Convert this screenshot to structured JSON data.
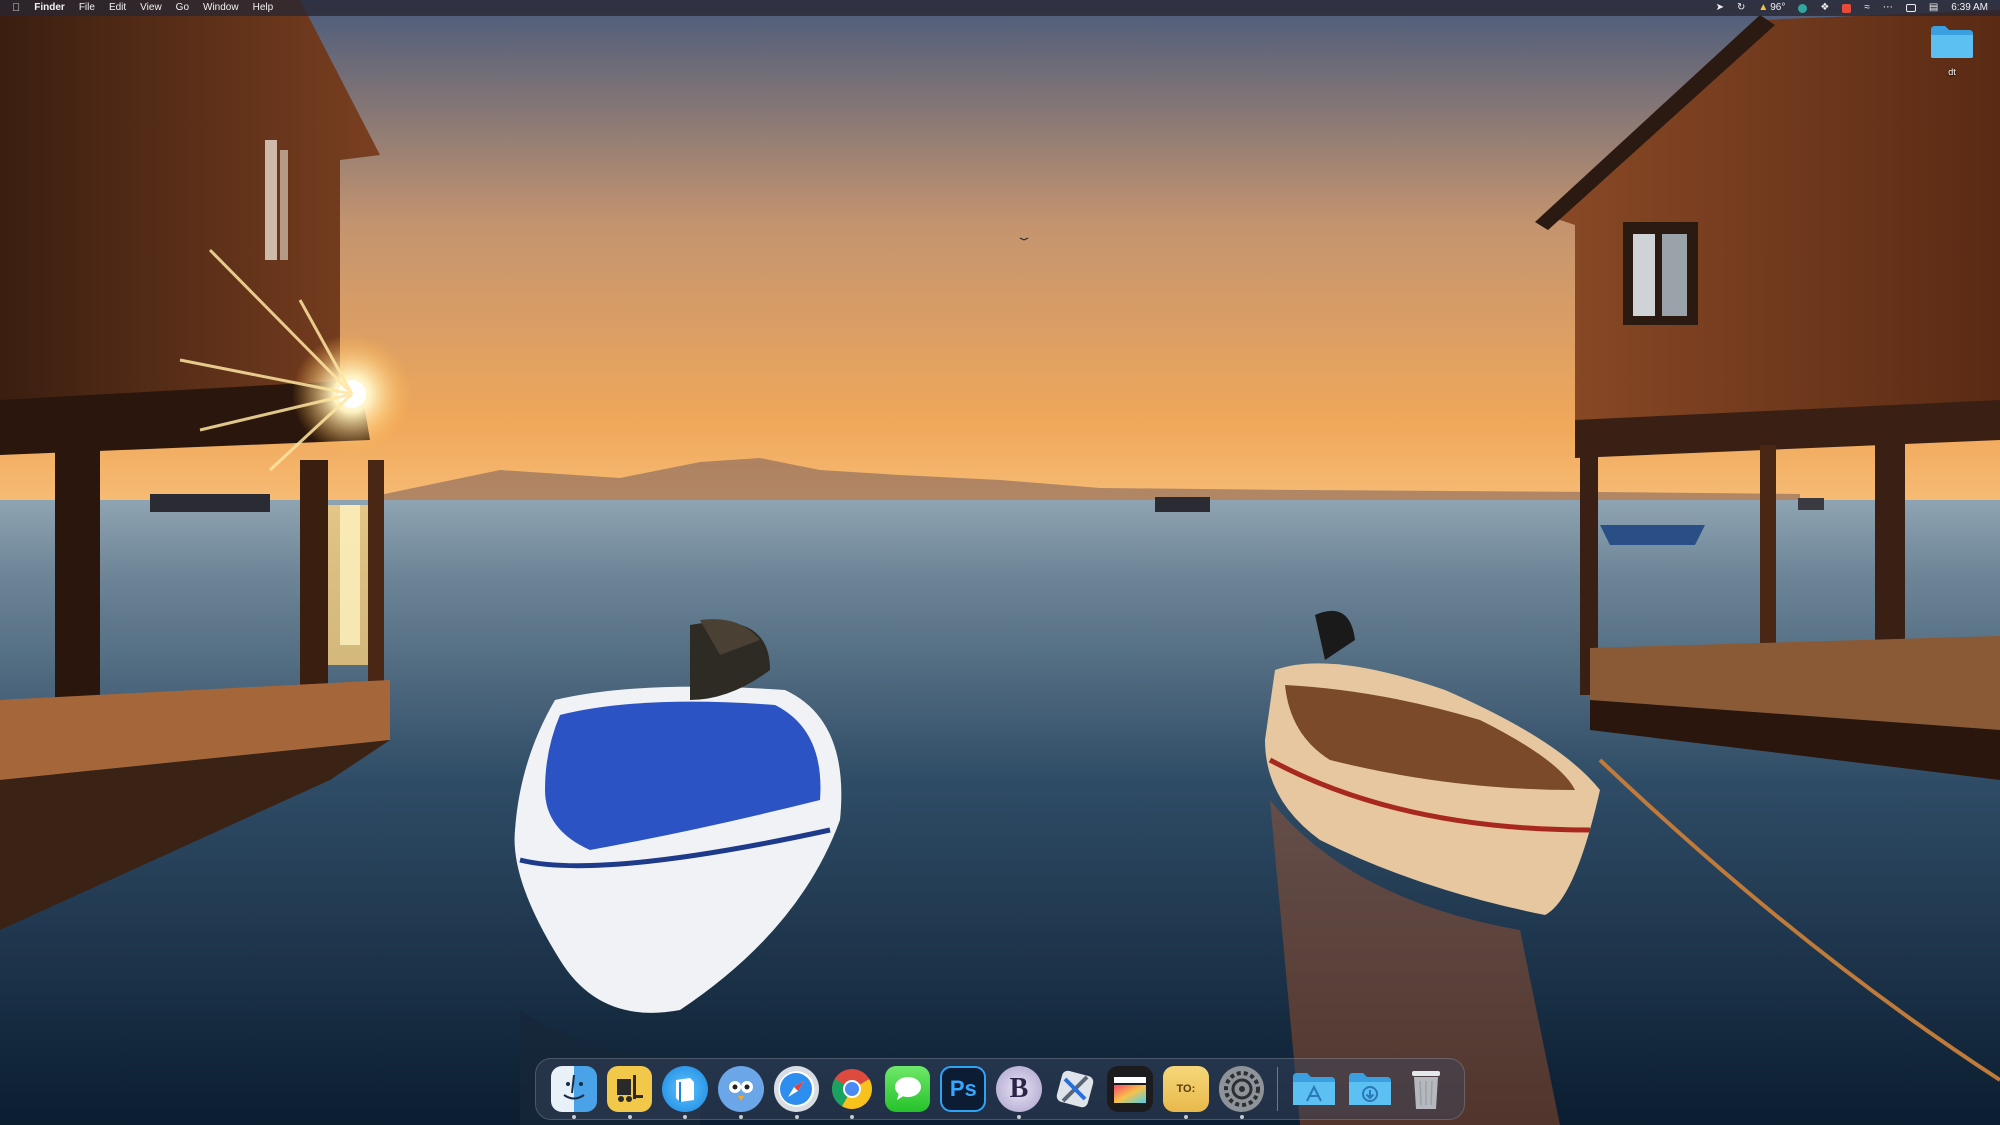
{
  "menubar": {
    "apple_icon": "apple-logo-icon",
    "app_name": "Finder",
    "menus": [
      "File",
      "Edit",
      "View",
      "Go",
      "Window",
      "Help"
    ],
    "status": {
      "location_icon": "location-arrow-icon",
      "sync_icon": "sync-icon",
      "temperature": "96°",
      "clock": "6:39 AM"
    }
  },
  "desktop": {
    "folder_label": "dt"
  },
  "dock": {
    "apps": [
      {
        "name": "Finder",
        "icon": "finder-icon"
      },
      {
        "name": "Forklift",
        "icon": "forklift-icon"
      },
      {
        "name": "Mail",
        "icon": "mail-icon"
      },
      {
        "name": "Tweetbot",
        "icon": "tweetbot-icon"
      },
      {
        "name": "Safari",
        "icon": "safari-icon"
      },
      {
        "name": "Chrome",
        "icon": "chrome-icon"
      },
      {
        "name": "Messages",
        "icon": "messages-icon"
      },
      {
        "name": "Photoshop",
        "icon": "photoshop-icon",
        "text": "Ps"
      },
      {
        "name": "BBEdit",
        "icon": "bbedit-icon",
        "text": "B"
      },
      {
        "name": "Xcode",
        "icon": "xcode-icon"
      },
      {
        "name": "Final Cut Pro",
        "icon": "final-cut-icon"
      },
      {
        "name": "Notes",
        "icon": "notes-icon",
        "text": "TO:"
      },
      {
        "name": "System Preferences",
        "icon": "system-preferences-icon"
      }
    ],
    "stacks": [
      {
        "name": "Applications",
        "icon": "applications-folder-icon"
      },
      {
        "name": "Downloads",
        "icon": "downloads-folder-icon"
      },
      {
        "name": "Trash",
        "icon": "trash-icon"
      }
    ]
  },
  "colors": {
    "folder_blue": "#4fb6ee",
    "sky_top": "#4a5b7c",
    "horizon": "#f0a85a",
    "water": "#0f2840"
  }
}
